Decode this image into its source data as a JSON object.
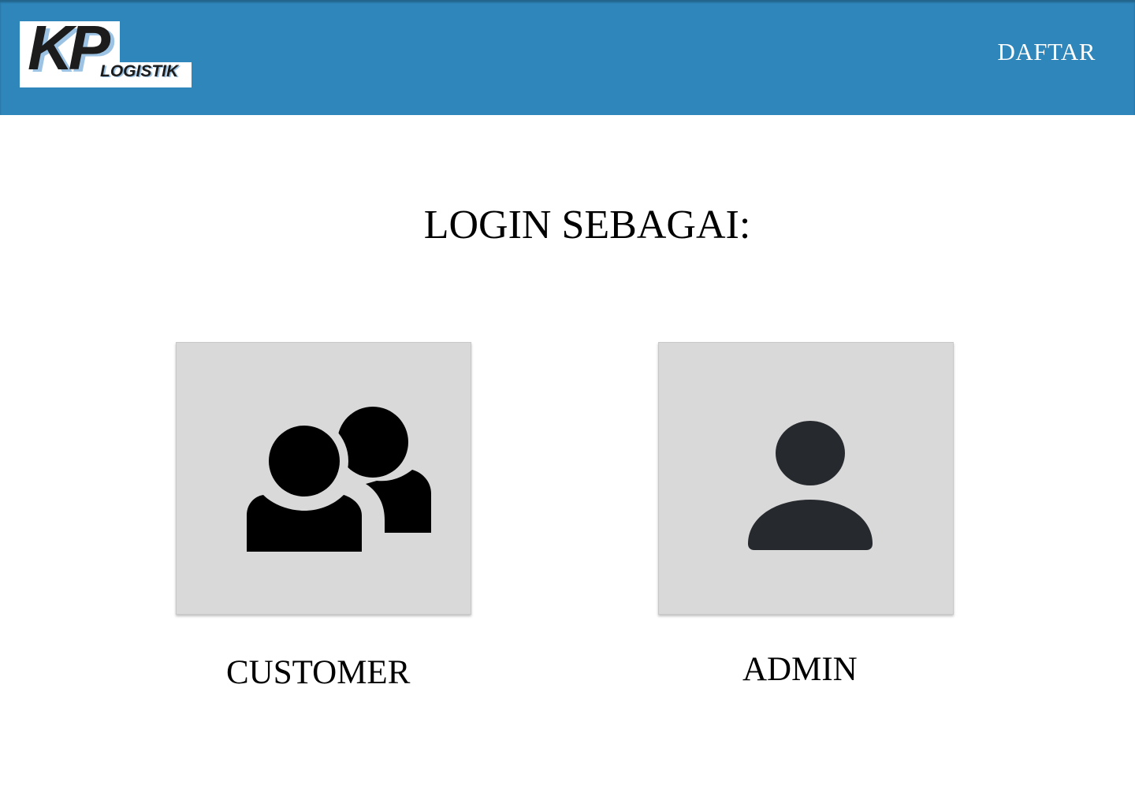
{
  "header": {
    "logo": {
      "mark": "KP",
      "subtitle": "LOGISTIK"
    },
    "nav": {
      "daftar_label": "DAFTAR"
    },
    "background_color": "#2e86bb"
  },
  "main": {
    "title": "LOGIN SEBAGAI:",
    "roles": [
      {
        "label": "CUSTOMER",
        "icon": "users-group-icon"
      },
      {
        "label": "ADMIN",
        "icon": "user-icon"
      }
    ]
  }
}
